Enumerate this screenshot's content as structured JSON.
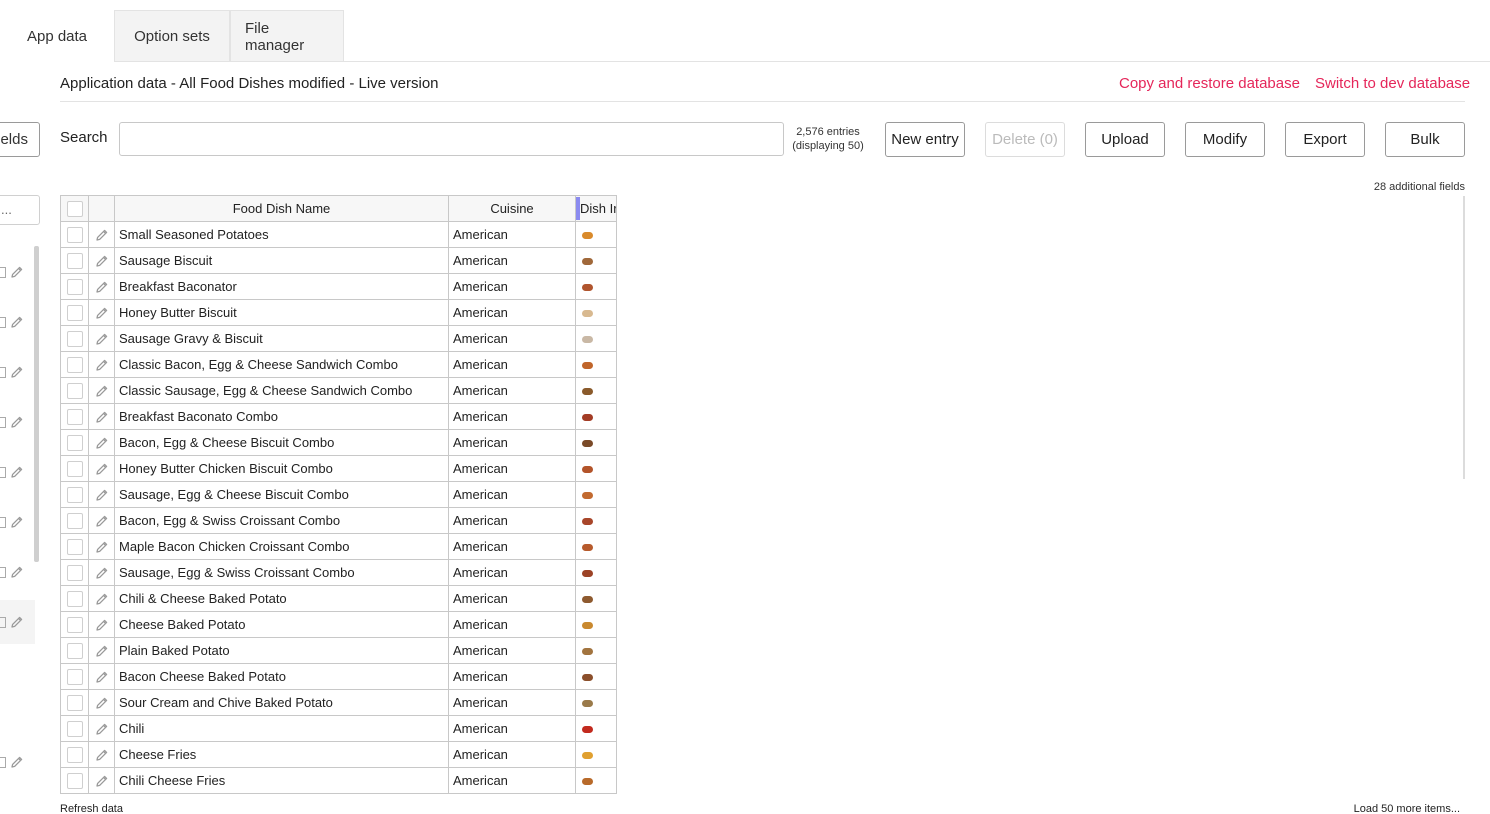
{
  "tabs": [
    {
      "label": "App data"
    },
    {
      "label": "Option sets"
    },
    {
      "label": "File manager"
    }
  ],
  "header": {
    "title": "Application data - All Food Dishes modified - Live version",
    "copy_restore_label": "Copy and restore database",
    "switch_db_label": "Switch to dev database",
    "link_color": "#e5265a"
  },
  "sidebar": {
    "fields_button_label": "elds",
    "filter_placeholder": "..."
  },
  "toolbar": {
    "search_label": "Search",
    "search_value": "",
    "entries_count": "2,576 entries",
    "displaying": "(displaying 50)",
    "new_entry_label": "New entry",
    "delete_label": "Delete (0)",
    "upload_label": "Upload",
    "modify_label": "Modify",
    "export_label": "Export",
    "bulk_label": "Bulk"
  },
  "additional_fields": "28 additional fields",
  "table": {
    "columns": [
      "Food Dish Name",
      "Cuisine",
      "Dish Ir"
    ],
    "rows": [
      {
        "name": "Small Seasoned Potatoes",
        "cuisine": "American",
        "icon": "#d98a2b"
      },
      {
        "name": "Sausage Biscuit",
        "cuisine": "American",
        "icon": "#a0683a"
      },
      {
        "name": "Breakfast Baconator",
        "cuisine": "American",
        "icon": "#b0552e"
      },
      {
        "name": "Honey Butter Biscuit",
        "cuisine": "American",
        "icon": "#d8b990"
      },
      {
        "name": "Sausage Gravy & Biscuit",
        "cuisine": "American",
        "icon": "#c9b8a5"
      },
      {
        "name": "Classic Bacon, Egg & Cheese Sandwich Combo",
        "cuisine": "American",
        "icon": "#c0652a"
      },
      {
        "name": "Classic Sausage, Egg & Cheese Sandwich Combo",
        "cuisine": "American",
        "icon": "#8a5a2b"
      },
      {
        "name": "Breakfast Baconato Combo",
        "cuisine": "American",
        "icon": "#a33c25"
      },
      {
        "name": "Bacon, Egg & Cheese Biscuit Combo",
        "cuisine": "American",
        "icon": "#7a4a28"
      },
      {
        "name": "Honey Butter Chicken Biscuit Combo",
        "cuisine": "American",
        "icon": "#b3542a"
      },
      {
        "name": "Sausage, Egg & Cheese Biscuit Combo",
        "cuisine": "American",
        "icon": "#c26a30"
      },
      {
        "name": "Bacon, Egg & Swiss Croissant Combo",
        "cuisine": "American",
        "icon": "#a8462a"
      },
      {
        "name": "Maple Bacon Chicken Croissant Combo",
        "cuisine": "American",
        "icon": "#b75a2c"
      },
      {
        "name": "Sausage, Egg & Swiss Croissant Combo",
        "cuisine": "American",
        "icon": "#9c4326"
      },
      {
        "name": "Chili & Cheese Baked Potato",
        "cuisine": "American",
        "icon": "#8e5a2f"
      },
      {
        "name": "Cheese Baked Potato",
        "cuisine": "American",
        "icon": "#c9892f"
      },
      {
        "name": "Plain Baked Potato",
        "cuisine": "American",
        "icon": "#a2743f"
      },
      {
        "name": "Bacon Cheese Baked Potato",
        "cuisine": "American",
        "icon": "#8b4f2b"
      },
      {
        "name": "Sour Cream and Chive Baked Potato",
        "cuisine": "American",
        "icon": "#9a7a4a"
      },
      {
        "name": "Chili",
        "cuisine": "American",
        "icon": "#c22a1e"
      },
      {
        "name": "Cheese Fries",
        "cuisine": "American",
        "icon": "#e0a030"
      },
      {
        "name": "Chili Cheese Fries",
        "cuisine": "American",
        "icon": "#b86a2a"
      }
    ]
  },
  "footer": {
    "refresh_label": "Refresh data",
    "load_more_label": "Load 50 more items..."
  }
}
